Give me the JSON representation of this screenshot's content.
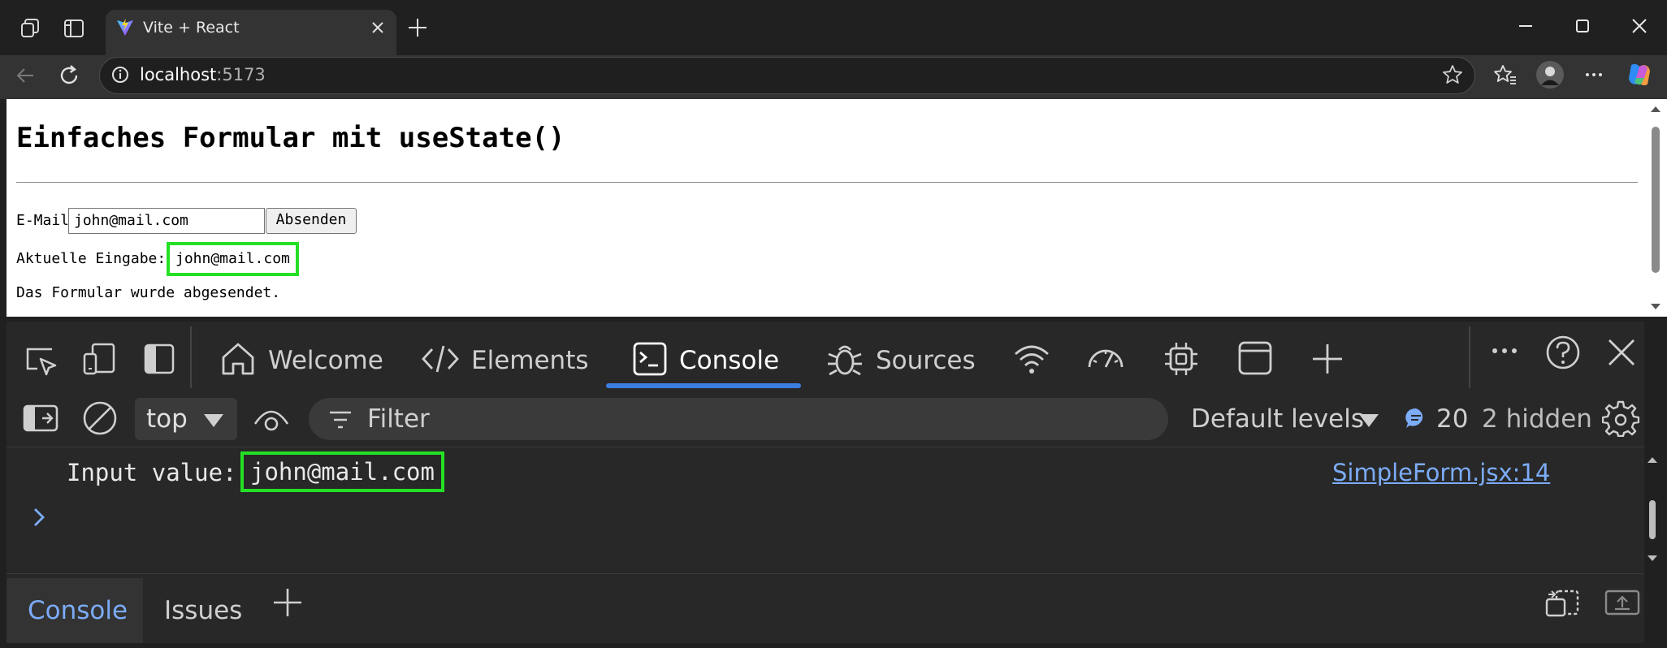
{
  "browser": {
    "tab_title": "Vite + React",
    "url_host": "localhost",
    "url_port": ":5173"
  },
  "page": {
    "heading": "Einfaches Formular mit useState()",
    "email_label": "E-Mail",
    "email_value": "john@mail.com",
    "submit_label": "Absenden",
    "current_label": "Aktuelle Eingabe:",
    "current_value": "john@mail.com",
    "submitted_message": "Das Formular wurde abgesendet."
  },
  "devtools": {
    "tabs": [
      {
        "label": "Welcome"
      },
      {
        "label": "Elements"
      },
      {
        "label": "Console"
      },
      {
        "label": "Sources"
      }
    ],
    "toolbar": {
      "context": "top",
      "filter_placeholder": "Filter",
      "levels": "Default levels",
      "message_count": "20",
      "hidden": "2 hidden"
    },
    "log": {
      "text": "Input value:",
      "value": "john@mail.com",
      "source": "SimpleForm.jsx:14"
    },
    "drawer": {
      "tab_console": "Console",
      "tab_issues": "Issues"
    }
  },
  "colors": {
    "highlight": "#24e024",
    "accent": "#3b7ee0",
    "link": "#7cacf8"
  },
  "icons": [
    "workspaces-icon",
    "tab-actions-icon",
    "vite-logo-icon",
    "close-icon",
    "new-tab-icon",
    "minimize-icon",
    "maximize-icon",
    "window-close-icon",
    "back-icon",
    "refresh-icon",
    "site-info-icon",
    "favorite-star-icon",
    "favorites-icon",
    "profile-avatar-icon",
    "more-icon",
    "copilot-icon"
  ]
}
